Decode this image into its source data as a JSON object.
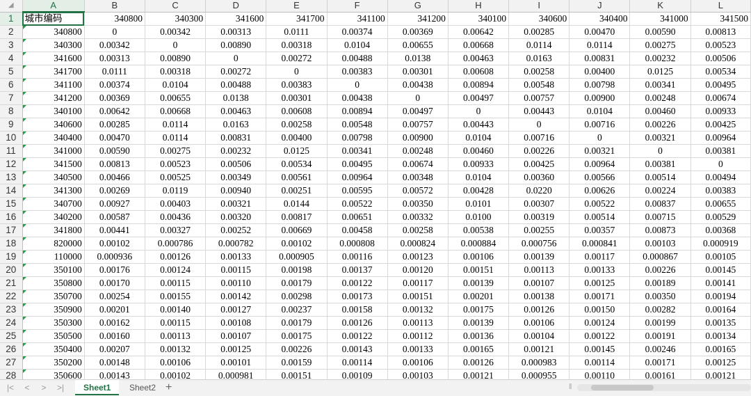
{
  "columns": [
    "A",
    "B",
    "C",
    "D",
    "E",
    "F",
    "G",
    "H",
    "I",
    "J",
    "K",
    "L"
  ],
  "header_row": {
    "row_number": "1",
    "a_label": "城市编码",
    "codes": [
      "340800",
      "340300",
      "341600",
      "341700",
      "341100",
      "341200",
      "340100",
      "340600",
      "340400",
      "341000",
      "341500"
    ]
  },
  "rows": [
    {
      "n": "2",
      "code": "340800",
      "v": [
        "0",
        "0.00342",
        "0.00313",
        "0.0111",
        "0.00374",
        "0.00369",
        "0.00642",
        "0.00285",
        "0.00470",
        "0.00590",
        "0.00813"
      ]
    },
    {
      "n": "3",
      "code": "340300",
      "v": [
        "0.00342",
        "0",
        "0.00890",
        "0.00318",
        "0.0104",
        "0.00655",
        "0.00668",
        "0.0114",
        "0.0114",
        "0.00275",
        "0.00523"
      ]
    },
    {
      "n": "4",
      "code": "341600",
      "v": [
        "0.00313",
        "0.00890",
        "0",
        "0.00272",
        "0.00488",
        "0.0138",
        "0.00463",
        "0.0163",
        "0.00831",
        "0.00232",
        "0.00506"
      ]
    },
    {
      "n": "5",
      "code": "341700",
      "v": [
        "0.0111",
        "0.00318",
        "0.00272",
        "0",
        "0.00383",
        "0.00301",
        "0.00608",
        "0.00258",
        "0.00400",
        "0.0125",
        "0.00534"
      ]
    },
    {
      "n": "6",
      "code": "341100",
      "v": [
        "0.00374",
        "0.0104",
        "0.00488",
        "0.00383",
        "0",
        "0.00438",
        "0.00894",
        "0.00548",
        "0.00798",
        "0.00341",
        "0.00495"
      ]
    },
    {
      "n": "7",
      "code": "341200",
      "v": [
        "0.00369",
        "0.00655",
        "0.0138",
        "0.00301",
        "0.00438",
        "0",
        "0.00497",
        "0.00757",
        "0.00900",
        "0.00248",
        "0.00674"
      ]
    },
    {
      "n": "8",
      "code": "340100",
      "v": [
        "0.00642",
        "0.00668",
        "0.00463",
        "0.00608",
        "0.00894",
        "0.00497",
        "0",
        "0.00443",
        "0.0104",
        "0.00460",
        "0.00933"
      ]
    },
    {
      "n": "9",
      "code": "340600",
      "v": [
        "0.00285",
        "0.0114",
        "0.0163",
        "0.00258",
        "0.00548",
        "0.00757",
        "0.00443",
        "0",
        "0.00716",
        "0.00226",
        "0.00425"
      ]
    },
    {
      "n": "10",
      "code": "340400",
      "v": [
        "0.00470",
        "0.0114",
        "0.00831",
        "0.00400",
        "0.00798",
        "0.00900",
        "0.0104",
        "0.00716",
        "0",
        "0.00321",
        "0.00964"
      ]
    },
    {
      "n": "11",
      "code": "341000",
      "v": [
        "0.00590",
        "0.00275",
        "0.00232",
        "0.0125",
        "0.00341",
        "0.00248",
        "0.00460",
        "0.00226",
        "0.00321",
        "0",
        "0.00381"
      ]
    },
    {
      "n": "12",
      "code": "341500",
      "v": [
        "0.00813",
        "0.00523",
        "0.00506",
        "0.00534",
        "0.00495",
        "0.00674",
        "0.00933",
        "0.00425",
        "0.00964",
        "0.00381",
        "0"
      ]
    },
    {
      "n": "13",
      "code": "340500",
      "v": [
        "0.00466",
        "0.00525",
        "0.00349",
        "0.00561",
        "0.00964",
        "0.00348",
        "0.0104",
        "0.00360",
        "0.00566",
        "0.00514",
        "0.00494"
      ]
    },
    {
      "n": "14",
      "code": "341300",
      "v": [
        "0.00269",
        "0.0119",
        "0.00940",
        "0.00251",
        "0.00595",
        "0.00572",
        "0.00428",
        "0.0220",
        "0.00626",
        "0.00224",
        "0.00383"
      ]
    },
    {
      "n": "15",
      "code": "340700",
      "v": [
        "0.00927",
        "0.00403",
        "0.00321",
        "0.0144",
        "0.00522",
        "0.00350",
        "0.0101",
        "0.00307",
        "0.00522",
        "0.00837",
        "0.00655"
      ]
    },
    {
      "n": "16",
      "code": "340200",
      "v": [
        "0.00587",
        "0.00436",
        "0.00320",
        "0.00817",
        "0.00651",
        "0.00332",
        "0.0100",
        "0.00319",
        "0.00514",
        "0.00715",
        "0.00529"
      ]
    },
    {
      "n": "17",
      "code": "341800",
      "v": [
        "0.00441",
        "0.00327",
        "0.00252",
        "0.00669",
        "0.00458",
        "0.00258",
        "0.00538",
        "0.00255",
        "0.00357",
        "0.00873",
        "0.00368"
      ]
    },
    {
      "n": "18",
      "code": "820000",
      "v": [
        "0.00102",
        "0.000786",
        "0.000782",
        "0.00102",
        "0.000808",
        "0.000824",
        "0.000884",
        "0.000756",
        "0.000841",
        "0.00103",
        "0.000919"
      ]
    },
    {
      "n": "19",
      "code": "110000",
      "v": [
        "0.000936",
        "0.00126",
        "0.00133",
        "0.000905",
        "0.00116",
        "0.00123",
        "0.00106",
        "0.00139",
        "0.00117",
        "0.000867",
        "0.00105"
      ]
    },
    {
      "n": "20",
      "code": "350100",
      "v": [
        "0.00176",
        "0.00124",
        "0.00115",
        "0.00198",
        "0.00137",
        "0.00120",
        "0.00151",
        "0.00113",
        "0.00133",
        "0.00226",
        "0.00145"
      ]
    },
    {
      "n": "21",
      "code": "350800",
      "v": [
        "0.00170",
        "0.00115",
        "0.00110",
        "0.00179",
        "0.00122",
        "0.00117",
        "0.00139",
        "0.00107",
        "0.00125",
        "0.00189",
        "0.00141"
      ]
    },
    {
      "n": "22",
      "code": "350700",
      "v": [
        "0.00254",
        "0.00155",
        "0.00142",
        "0.00298",
        "0.00173",
        "0.00151",
        "0.00201",
        "0.00138",
        "0.00171",
        "0.00350",
        "0.00194"
      ]
    },
    {
      "n": "23",
      "code": "350900",
      "v": [
        "0.00201",
        "0.00140",
        "0.00127",
        "0.00237",
        "0.00158",
        "0.00132",
        "0.00175",
        "0.00126",
        "0.00150",
        "0.00282",
        "0.00164"
      ]
    },
    {
      "n": "24",
      "code": "350300",
      "v": [
        "0.00162",
        "0.00115",
        "0.00108",
        "0.00179",
        "0.00126",
        "0.00113",
        "0.00139",
        "0.00106",
        "0.00124",
        "0.00199",
        "0.00135"
      ]
    },
    {
      "n": "25",
      "code": "350500",
      "v": [
        "0.00160",
        "0.00113",
        "0.00107",
        "0.00175",
        "0.00122",
        "0.00112",
        "0.00136",
        "0.00104",
        "0.00122",
        "0.00191",
        "0.00134"
      ]
    },
    {
      "n": "26",
      "code": "350400",
      "v": [
        "0.00207",
        "0.00132",
        "0.00125",
        "0.00226",
        "0.00143",
        "0.00133",
        "0.00165",
        "0.00121",
        "0.00145",
        "0.00246",
        "0.00165"
      ]
    },
    {
      "n": "27",
      "code": "350200",
      "v": [
        "0.00148",
        "0.00106",
        "0.00101",
        "0.00159",
        "0.00114",
        "0.00106",
        "0.00126",
        "0.000983",
        "0.00114",
        "0.00171",
        "0.00125"
      ]
    },
    {
      "n": "28",
      "code": "350600",
      "v": [
        "0.00143",
        "0.00102",
        "0.000981",
        "0.00151",
        "0.00109",
        "0.00103",
        "0.00121",
        "0.000955",
        "0.00110",
        "0.00161",
        "0.00121"
      ]
    }
  ],
  "sheet_tabs": [
    "Sheet1",
    "Sheet2"
  ],
  "active_sheet": "Sheet1",
  "add_sheet_label": "+",
  "nav": {
    "first": "|<",
    "prev": "<",
    "next": ">",
    "last": ">|"
  },
  "colors": {
    "accent": "#217346",
    "grid": "#d9d9d9",
    "header_bg": "#f2f2f2",
    "triangle": "#1fa03a"
  }
}
